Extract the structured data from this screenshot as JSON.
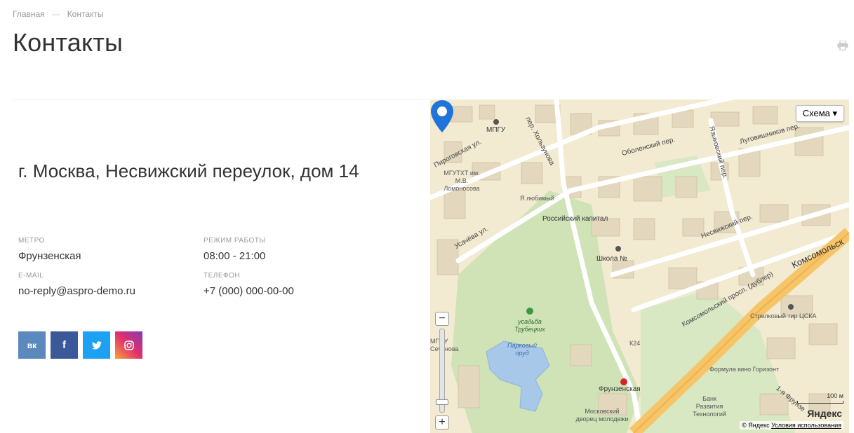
{
  "breadcrumb": {
    "home": "Главная",
    "separator": "—",
    "current": "Контакты"
  },
  "page": {
    "title": "Контакты"
  },
  "contact": {
    "address": "г. Москва, Несвижский переулок, дом 14",
    "metro_label": "МЕТРО",
    "metro_value": "Фрунзенская",
    "hours_label": "РЕЖИМ РАБОТЫ",
    "hours_value": "08:00 - 21:00",
    "email_label": "E-MAIL",
    "email_value": "no-reply@aspro-demo.ru",
    "phone_label": "ТЕЛЕФОН",
    "phone_value": "+7 (000) 000-00-00"
  },
  "socials": [
    {
      "name": "vk",
      "glyph": "вк",
      "color": "#5b88bd"
    },
    {
      "name": "facebook",
      "glyph": "f",
      "color": "#3b5998"
    },
    {
      "name": "twitter",
      "glyph": "t",
      "color": "#1da1f2"
    },
    {
      "name": "instagram",
      "glyph": "ig",
      "color": "#e1306c"
    }
  ],
  "map": {
    "layer_button": "Схема ▾",
    "zoom_in": "+",
    "zoom_out": "−",
    "scale": "100 м",
    "logo": "Яндекс",
    "copyright": "© Яндекс",
    "terms": "Условия использования",
    "pin_color": "#1e74d8",
    "labels": {
      "mpgu": "МПГУ",
      "mgutht": "МГУТХТ им. М.В. Ломоносова",
      "ya_lyubimy": "Я любимый",
      "ros_kapital": "Российский капитал",
      "shkola": "Школа №",
      "usadba": "усадьба Трубецких",
      "parkovy": "Парковый пруд",
      "frunzenskaya": "Фрунзенская",
      "mosk_dvorets": "Московский дворец молодежи",
      "strelkovy": "Стрелковый тир ЦСКА",
      "formula": "Формула кино Горизонт",
      "bank": "Банк Развития Технологий",
      "k24": "К24",
      "sechenova": "МГМУ Сеченова",
      "pirogovskaya": "Пироговская ул.",
      "holzunova": "пер. Хользунова",
      "usachyova": "Усачёва ул.",
      "obolensky": "Оболенский пер.",
      "yazykovsky": "Языковский пер.",
      "lugovishnikov": "Луговишников пер.",
      "nesvizhsky": "Несвижский пер.",
      "komsomolsky_dubler": "Комсомольский просп. (дублер)",
      "komsomolsky": "Комсомольск",
      "frunzenskaya_nab": "1-я Фрунзе"
    }
  }
}
